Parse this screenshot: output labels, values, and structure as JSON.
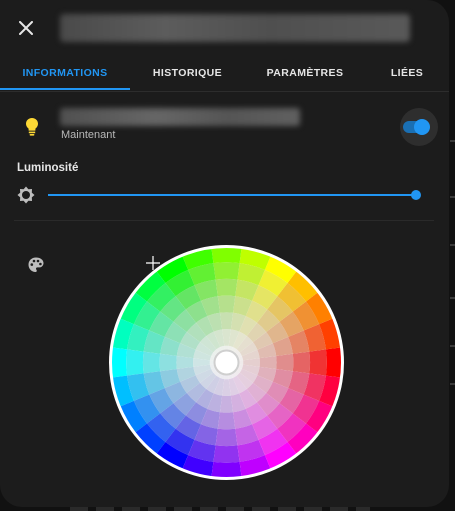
{
  "dialog": {
    "close_icon": "close-icon",
    "tabs": [
      {
        "label": "INFORMATIONS",
        "active": true
      },
      {
        "label": "HISTORIQUE",
        "active": false
      },
      {
        "label": "PARAMÈTRES",
        "active": false
      },
      {
        "label": "LIÉES",
        "active": false
      }
    ]
  },
  "entity": {
    "icon": "lightbulb-icon",
    "last_changed": "Maintenant",
    "state_on": true,
    "accent_color": "#2196f3",
    "bulb_color": "#fdd835"
  },
  "brightness": {
    "label": "Luminosité",
    "icon": "brightness-icon",
    "value_percent": 100
  },
  "color": {
    "icon": "palette-icon",
    "picker": "color-wheel"
  }
}
